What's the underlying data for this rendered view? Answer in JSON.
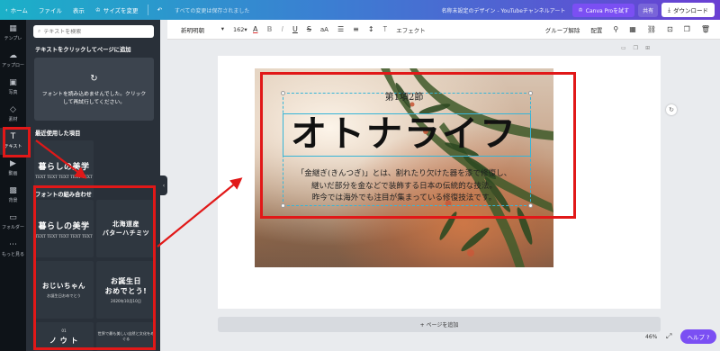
{
  "topbar": {
    "home": "ホーム",
    "file": "ファイル",
    "view": "表示",
    "resize": "サイズを変更",
    "saved_status": "すべての変更は保存されました",
    "doc_title": "名称未設定のデザイン - YouTubeチャンネルアート",
    "pro_button": "Canva Proを試す",
    "share": "共有",
    "download": "ダウンロード"
  },
  "rail": {
    "items": [
      {
        "label": "テンプレ",
        "icon": "template-icon"
      },
      {
        "label": "アップロー",
        "icon": "upload-icon"
      },
      {
        "label": "写真",
        "icon": "photo-icon"
      },
      {
        "label": "素材",
        "icon": "elements-icon"
      },
      {
        "label": "テキスト",
        "icon": "text-icon"
      },
      {
        "label": "動画",
        "icon": "video-icon"
      },
      {
        "label": "背景",
        "icon": "background-icon"
      },
      {
        "label": "フォルダー",
        "icon": "folder-icon"
      },
      {
        "label": "もっと見る",
        "icon": "more-icon"
      }
    ]
  },
  "panel": {
    "search_placeholder": "テキストを検索",
    "add_text_heading": "テキストをクリックしてページに追加",
    "load_error": "フォントを読み込めませんでした。クリックして再試行してください。",
    "recent_heading": "最近使用した項目",
    "recent_tile": {
      "big": "暮らしの美学",
      "small": "TEXT TEXT TEXT TEXT TEXT"
    },
    "combo_heading": "フォントの組み合わせ",
    "combos": [
      {
        "big": "暮らしの美学",
        "small": "TEXT TEXT TEXT TEXT TEXT"
      },
      {
        "big": "北海道産\nバターハチミツ",
        "small": ""
      },
      {
        "big": "おじいちゃん",
        "small": "お誕生日おめでとう"
      },
      {
        "big": "お誕生日\nおめでとう!",
        "small": "2020年10月10日"
      },
      {
        "big": "ノ ウ ト",
        "small": "01"
      },
      {
        "big": "",
        "small": "世界で最も美しい自然と文化をめぐる"
      }
    ]
  },
  "toolbar": {
    "font": "新明明朝",
    "size": "162",
    "effects": "エフェクト",
    "ungroup": "グループ解除",
    "arrange": "配置"
  },
  "canvas": {
    "chapter": "第1項2節",
    "main_title": "オトナライフ",
    "description": [
      "「金継ぎ(きんつぎ)」とは、割れたり欠けた器を漆で修復し、",
      "継いだ部分を金などで装飾する日本の伝統的な技法。",
      "昨今では海外でも注目が集まっている修復技法です。"
    ],
    "add_page": "+ ページを追加",
    "zoom": "46%",
    "help": "ヘルプ ?"
  },
  "colors": {
    "highlight": "#e11818",
    "selection": "#36b5d8",
    "accent": "#7b4ff3"
  }
}
